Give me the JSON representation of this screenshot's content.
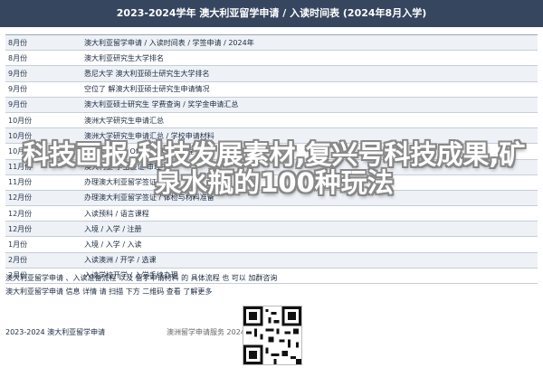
{
  "header": {
    "title": "2023-2024学年 澳大利亚留学申请 / 入读时间表 (2024年8月入学)"
  },
  "rows": [
    {
      "date": "8月份",
      "desc": "澳大利亚留学申请 / 入读时间表 / 学签申请 / 2024年"
    },
    {
      "date": "8月份",
      "desc": "澳大利亚研究生大学排名"
    },
    {
      "date": "9月份",
      "desc": "悉尼大学 澳大利亚硕士研究生大学排名"
    },
    {
      "date": "9月份",
      "desc": "空位了 解澳大利亚硕士研究生申请情况"
    },
    {
      "date": "9月份",
      "desc": "澳大利亚硕士研究生 学费查询 / 奖学金申请汇总"
    },
    {
      "date": "10月份",
      "desc": "澳洲大学研究生申请汇总"
    },
    {
      "date": "10月份",
      "desc": "澳洲大学研究生申请汇总 / 学校申请材料"
    },
    {
      "date": "10月份",
      "desc": "入读澳大利亚 Offer 后续办理流程"
    },
    {
      "date": "11月份",
      "desc": "澳大利亚 学生签证 审理中"
    },
    {
      "date": "11月份",
      "desc": "办理澳大利亚留学签证"
    },
    {
      "date": "12月份",
      "desc": "办理澳大利亚留学签证 / 体检与材料准备"
    },
    {
      "date": "12月份",
      "desc": "入读预科 / 语言课程"
    },
    {
      "date": "12月份",
      "desc": "入境 / 入学 / 注册"
    },
    {
      "date": "1月份",
      "desc": "入境 / 入学 / 入读"
    },
    {
      "date": "2月份",
      "desc": "入读澳洲 / 开学 / 选课"
    },
    {
      "date": "2月份",
      "desc": "入读学校开学 / 入学手续办理"
    }
  ],
  "notes": [
    "澳大利亚留学申请 、入读准备流程 以及 留学申请材料 的 具体流程 也 可以 加群咨询",
    "澳大利亚留学申请 信息 详情 请 扫描 下方 二维码 查看 了解更多"
  ],
  "footer": {
    "left": "2023-2024 澳大利亚留学申请",
    "right": "澳洲留学申请服务 2024"
  },
  "overlay": {
    "title": "科技画报,科技发展素材,复兴号科技成果,矿泉水瓶的100种玩法"
  },
  "colors": {
    "header_bg": "#36465f",
    "row_alt": "#eef1f6",
    "row_border": "#c7ced8"
  },
  "icons": {
    "qr": "qr-code-icon"
  }
}
